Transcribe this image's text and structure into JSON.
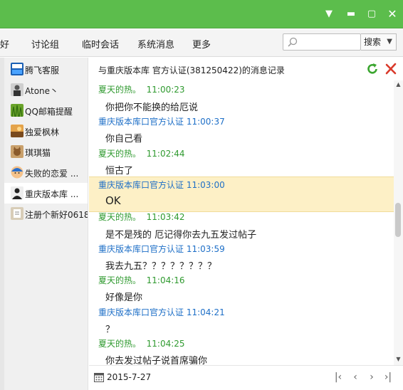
{
  "tabs": [
    {
      "label": "好"
    },
    {
      "label": "讨论组"
    },
    {
      "label": "临时会话"
    },
    {
      "label": "系统消息"
    },
    {
      "label": "更多"
    }
  ],
  "search": {
    "placeholder": "",
    "button_label": "搜索"
  },
  "contacts": [
    {
      "name": "腾飞客服",
      "avatar": "tengfei-logo"
    },
    {
      "name": "Atone丶",
      "avatar": "person-photo"
    },
    {
      "name": "QQ邮箱提醒",
      "avatar": "grass-photo"
    },
    {
      "name": "独爱枫林",
      "avatar": "landscape-photo"
    },
    {
      "name": "琪琪猫",
      "avatar": "cat-photo"
    },
    {
      "name": "失败的恋爱 ...",
      "avatar": "cartoon-avatar"
    },
    {
      "name": "重庆版本库 ...",
      "avatar": "person-silhouette"
    },
    {
      "name": "注册个新好0618",
      "avatar": "doc-avatar"
    }
  ],
  "header": {
    "title": "与重庆版本库  官方认证(381250422)的消息记录"
  },
  "messages": [
    {
      "sender": "夏天的热。",
      "time": "11:00:23",
      "text": "你把你不能换的给厄说",
      "type": "me"
    },
    {
      "sender": "重庆版本库口官方认证",
      "time": "11:00:37",
      "text": "你自己看",
      "type": "other"
    },
    {
      "sender": "夏天的热。",
      "time": "11:02:44",
      "text": "恒古了",
      "type": "me"
    },
    {
      "sender": "重庆版本库口官方认证",
      "time": "11:03:00",
      "text": "OK",
      "type": "other"
    },
    {
      "sender": "夏天的热。",
      "time": "11:03:42",
      "text": "是不是残的 厄记得你去九五发过帖子",
      "type": "me"
    },
    {
      "sender": "重庆版本库口官方认证",
      "time": "11:03:59",
      "text": "我去九五？？？？？？？？",
      "type": "other"
    },
    {
      "sender": "夏天的热。",
      "time": "11:04:16",
      "text": "好像是你",
      "type": "me"
    },
    {
      "sender": "重庆版本库口官方认证",
      "time": "11:04:21",
      "text": "？",
      "type": "other"
    },
    {
      "sender": "夏天的热。",
      "time": "11:04:25",
      "text": "你去发过帖子说首席骗你",
      "type": "me"
    }
  ],
  "footer": {
    "date": "2015-7-27"
  },
  "colors": {
    "titlebar": "#5cbd4c",
    "me": "#2f9a2f",
    "other": "#1e6fc7",
    "highlight": "#fdf0c6"
  }
}
